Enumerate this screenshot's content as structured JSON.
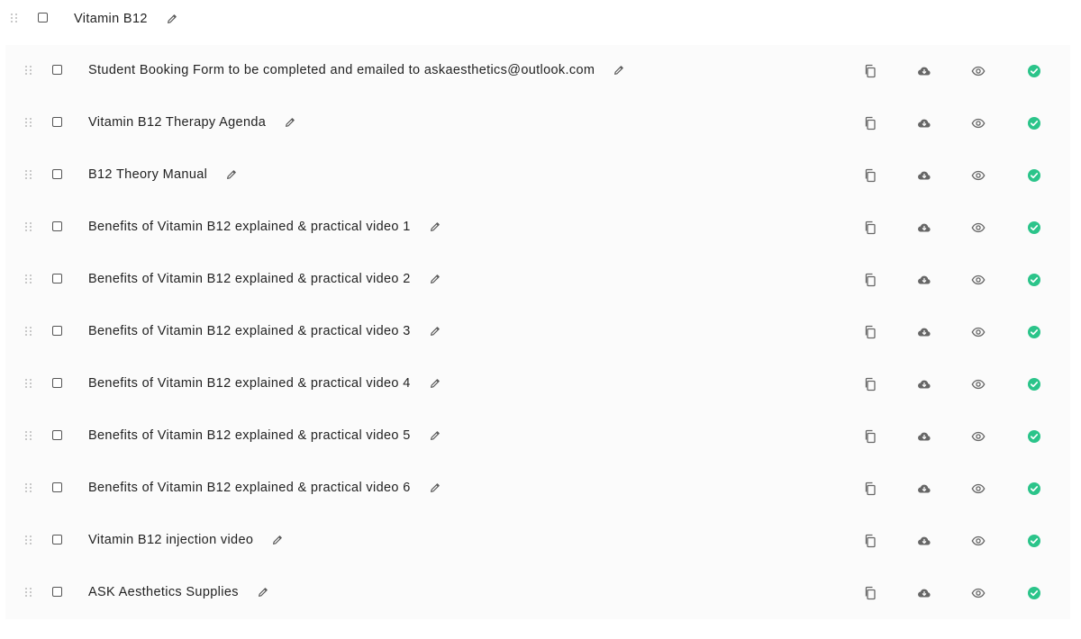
{
  "section": {
    "title": "Vitamin B12"
  },
  "lessons": [
    {
      "title": "Student Booking Form to be completed and emailed to askaesthetics@outlook.com"
    },
    {
      "title": "Vitamin B12 Therapy Agenda"
    },
    {
      "title": "B12 Theory Manual"
    },
    {
      "title": "Benefits of Vitamin B12 explained & practical video 1"
    },
    {
      "title": "Benefits of Vitamin B12 explained & practical video 2"
    },
    {
      "title": "Benefits of Vitamin B12 explained & practical video 3"
    },
    {
      "title": "Benefits of Vitamin B12 explained & practical video 4"
    },
    {
      "title": "Benefits of Vitamin B12 explained & practical video 5"
    },
    {
      "title": "Benefits of Vitamin B12 explained & practical video 6"
    },
    {
      "title": "Vitamin B12 injection video"
    },
    {
      "title": "ASK Aesthetics Supplies"
    }
  ],
  "icons": {
    "drag": "drag-handle-icon",
    "checkbox": "checkbox",
    "edit": "pencil-icon",
    "copy": "copy-icon",
    "download": "cloud-download-icon",
    "preview": "eye-icon",
    "status": "check-circle-icon"
  },
  "colors": {
    "status_green": "#2bc48a",
    "icon_gray": "#666666",
    "panel_bg": "#fbfbfb"
  }
}
